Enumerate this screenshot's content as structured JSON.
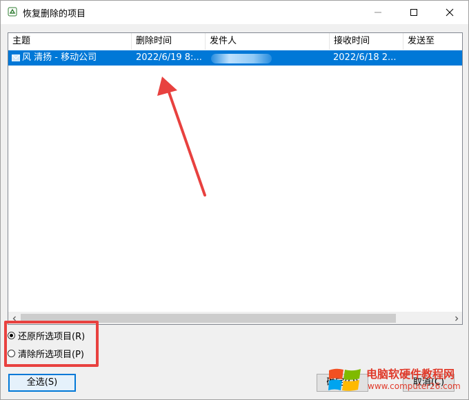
{
  "window": {
    "title": "恢复删除的项目"
  },
  "list": {
    "columns": [
      "主题",
      "删除时间",
      "发件人",
      "接收时间",
      "发送至"
    ],
    "rows": [
      {
        "subject": "风 清扬 - 移动公司",
        "deleted_time": "2022/6/19 8:...",
        "sender": "",
        "received_time": "2022/6/18 2...",
        "sent_to": ""
      }
    ]
  },
  "options": {
    "restore_label": "还原所选项目(R)",
    "purge_label": "清除所选项目(P)",
    "selected": "restore"
  },
  "buttons": {
    "select_all": "全选(S)",
    "ok": "确定(O)",
    "cancel": "取消(C)"
  },
  "watermark": {
    "title": "电脑软硬件教程网",
    "url": "www.computer26.com"
  },
  "colors": {
    "selection": "#0078d7",
    "annotation_red": "#e8413f"
  }
}
